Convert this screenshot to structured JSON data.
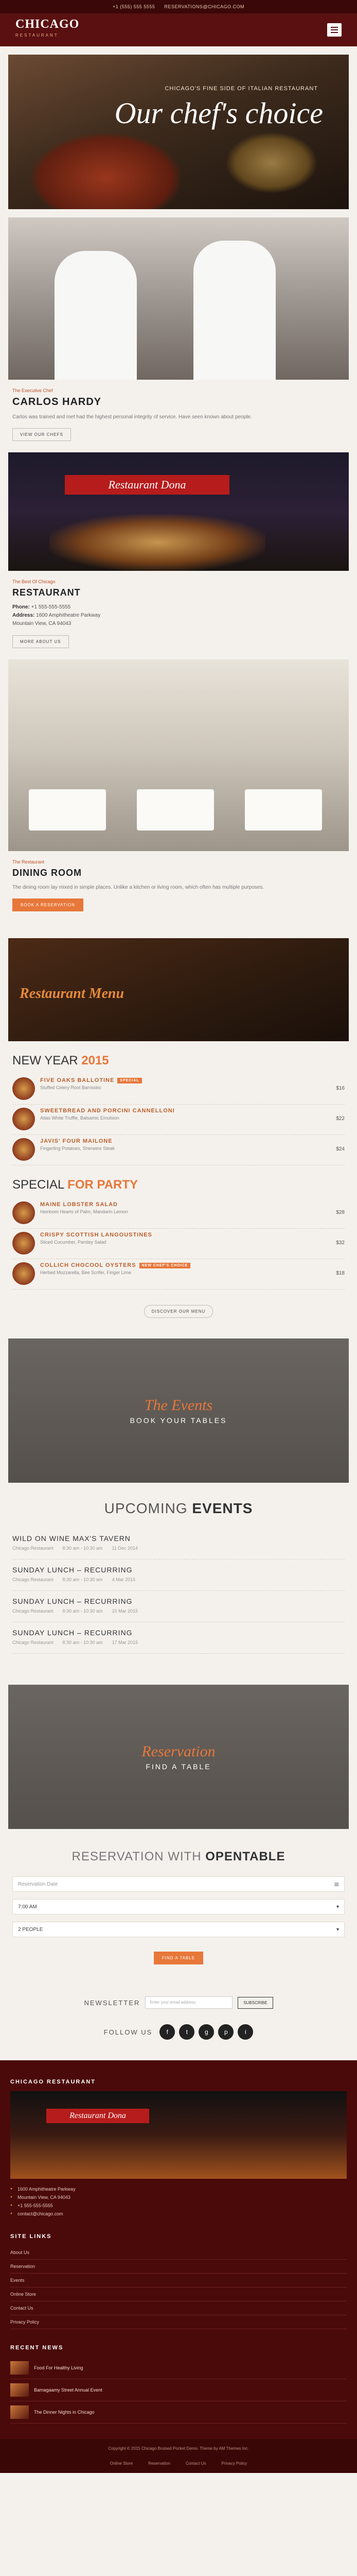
{
  "topbar": {
    "phone": "+1 (555) 555 5555",
    "email": "RESERVATIONS@CHICAGO.COM"
  },
  "brand": {
    "name": "CHICAGO",
    "sub": "RESTAURANT"
  },
  "hero": {
    "small": "CHICAGO'S FINE SIDE OF ITALIAN RESTAURANT",
    "big": "Our chef's choice"
  },
  "chef": {
    "kicker": "The Executive Chef",
    "title": "CARLOS HARDY",
    "text": "Carlos was trained and met had the highest personal integrity of service. Have seen known about people.",
    "button": "VIEW OUR CHEFS"
  },
  "restaurant": {
    "kicker": "The Best Of Chicago",
    "title": "RESTAURANT",
    "sign": "Restaurant Dona",
    "phone_label": "Phone:",
    "phone": "+1 555-555-5555",
    "address_label": "Address:",
    "address": "1600 Amphitheatre Parkway",
    "city": "Mountain View, CA 94043",
    "button": "MORE ABOUT US"
  },
  "dining": {
    "kicker": "The Restaurant",
    "title": "DINING ROOM",
    "text": "The dining room lay mixed in simple places. Unlike a kitchen or living room, which often has multiple purposes.",
    "button": "BOOK A RESERVATION"
  },
  "menu_banner": {
    "script": "Restaurant Menu",
    "sub": ""
  },
  "menu": {
    "groups": [
      {
        "title_a": "NEW YEAR",
        "title_b": "2015",
        "items": [
          {
            "name": "FIVE OAKS BALLOTINE",
            "tag": "SPECIAL",
            "desc": "Stuffed Celery Root Barrissko",
            "price": "$16"
          },
          {
            "name": "SWEETBREAD AND PORCINI CANNELLONI",
            "tag": "",
            "desc": "Atlas White Truffle, Balsamic Emulsion",
            "price": "$22"
          },
          {
            "name": "JAVIS' FOUR MAILONE",
            "tag": "",
            "desc": "Fingerling Potatoes, Sherwins Steak",
            "price": "$24"
          }
        ]
      },
      {
        "title_a": "SPECIAL",
        "title_b": "FOR PARTY",
        "items": [
          {
            "name": "MAINE LOBSTER SALAD",
            "tag": "",
            "desc": "Heirloom Hearts of Palm, Mandarin Lemon",
            "price": "$28"
          },
          {
            "name": "CRISPY SCOTTISH LANGOUSTINES",
            "tag": "",
            "desc": "Sliced Cucumber, Parsley Salad",
            "price": "$32"
          },
          {
            "name": "COLLICH CHOCOOL OYSTERS",
            "tag": "NEW CHEF'S CHOICE",
            "desc": "Herbed Mozzarella, Bee Scrifer, Finger Lime",
            "price": "$18"
          }
        ]
      }
    ],
    "button": "DISCOVER OUR MENU"
  },
  "events_banner": {
    "script": "The Events",
    "sub": "BOOK YOUR TABLES"
  },
  "events": {
    "head_a": "UPCOMING",
    "head_b": "EVENTS",
    "items": [
      {
        "name": "WILD ON WINE MAX'S TAVERN",
        "place": "Chicago Restaurant",
        "time": "8:30 am - 10:30 am",
        "date": "11 Dec 2014"
      },
      {
        "name": "SUNDAY LUNCH – RECURRING",
        "place": "Chicago Restaurant",
        "time": "8:30 am - 10:30 am",
        "date": "4 Mar 2015"
      },
      {
        "name": "SUNDAY LUNCH – RECURRING",
        "place": "Chicago Restaurant",
        "time": "8:30 am - 10:30 am",
        "date": "10 Mar 2015"
      },
      {
        "name": "SUNDAY LUNCH – RECURRING",
        "place": "Chicago Restaurant",
        "time": "8:30 am - 10:30 am",
        "date": "17 Mar 2015"
      }
    ]
  },
  "reservation_banner": {
    "script": "Reservation",
    "sub": "FIND A TABLE"
  },
  "reservation": {
    "head_a": "RESERVATION WITH",
    "head_b": "OPENTABLE",
    "date_placeholder": "Reservation Date",
    "time": "7:00 AM",
    "people": "2 PEOPLE",
    "button": "FIND A TABLE"
  },
  "newsletter": {
    "label": "NEWSLETTER",
    "placeholder": "Enter your email address",
    "button": "SUBSCRIBE"
  },
  "follow": {
    "label": "FOLLOW US",
    "icons": [
      "f",
      "t",
      "g",
      "p",
      "i"
    ]
  },
  "footer": {
    "heading": "CHICAGO RESTAURANT",
    "sign": "Restaurant Dona",
    "info": [
      "1600 Amphitheatre Parkway",
      "Mountain View, CA 94043",
      "+1 555-555-5555",
      "contact@chicago.com"
    ],
    "links_heading": "SITE LINKS",
    "links": [
      "About Us",
      "Reservation",
      "Events",
      "Online Store",
      "Contact Us",
      "Privacy Policy"
    ],
    "news_heading": "RECENT NEWS",
    "news": [
      "Food For Healthy Living",
      "Bamagaamy Street Annual Event",
      "The Dinner Nights in Chicago"
    ],
    "copyright": "Copyright © 2015 Chicago Bruised Pocket Demo. Theme by AM Themes Inc.",
    "bottom_links": [
      "Online Store",
      "Reservation",
      "Contact Us",
      "Privacy Policy"
    ]
  }
}
